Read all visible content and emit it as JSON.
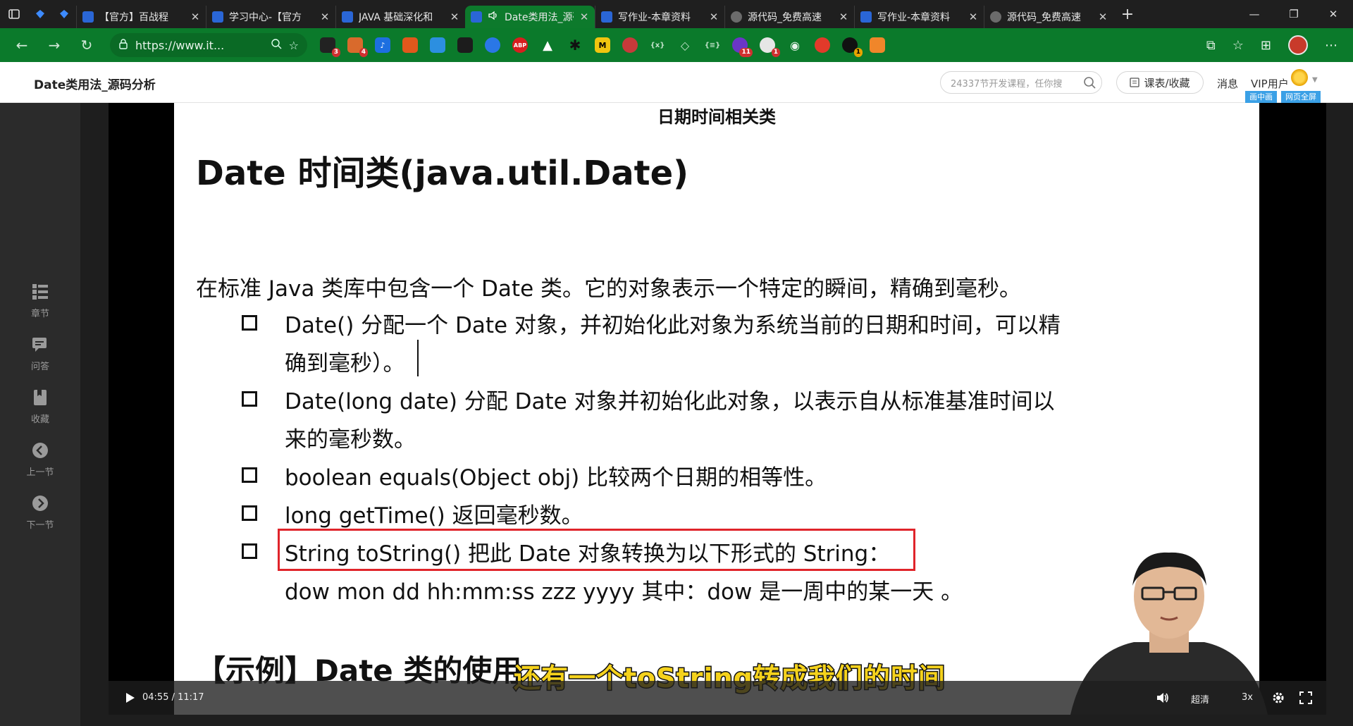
{
  "browser": {
    "tabs": [
      {
        "title": "【官方】百战程",
        "icon": "doc-icon"
      },
      {
        "title": "学习中心-【官方",
        "icon": "doc-icon"
      },
      {
        "title": "JAVA 基础深化和",
        "icon": "doc-icon"
      },
      {
        "title": "Date类用法_源码",
        "icon": "speaker-icon",
        "active": true
      },
      {
        "title": "写作业-本章资料",
        "icon": "doc-icon"
      },
      {
        "title": "源代码_免费高速",
        "icon": "cloud-icon"
      },
      {
        "title": "写作业-本章资料",
        "icon": "doc-icon"
      },
      {
        "title": "源代码_免费高速",
        "icon": "cloud-icon"
      }
    ],
    "url": "https://www.it...",
    "extension_badges": [
      "3",
      "4",
      "11",
      "1",
      "1"
    ],
    "accent": "#0b7a2b"
  },
  "site": {
    "page_title": "Date类用法_源码分析",
    "search_placeholder": "24337节开发课程，任你搜",
    "course_button": "课表/收藏",
    "messages": "消息",
    "vip": "VIP用户",
    "pip": "画中画",
    "webfull": "网页全屏"
  },
  "sidebar": {
    "items": [
      {
        "label": "章节",
        "icon": "chapters-icon"
      },
      {
        "label": "问答",
        "icon": "qa-icon"
      },
      {
        "label": "收藏",
        "icon": "bookmark-icon"
      },
      {
        "label": "上一节",
        "icon": "prev-icon"
      },
      {
        "label": "下一节",
        "icon": "next-icon"
      }
    ]
  },
  "slide": {
    "header": "日期时间相关类",
    "title": "Date 时间类(java.util.Date)",
    "intro": "在标准 Java 类库中包含一个 Date 类。它的对象表示一个特定的瞬间，精确到毫秒。",
    "bullets": [
      {
        "line1": "Date()  分配一个 Date 对象，并初始化此对象为系统当前的日期和时间，可以精",
        "line2": "确到毫秒）。"
      },
      {
        "line1": "Date(long date)  分配  Date  对象并初始化此对象，以表示自从标准基准时间以",
        "line2": "来的毫秒数。"
      },
      {
        "line1": "boolean equals(Object obj)  比较两个日期的相等性。"
      },
      {
        "line1": "long getTime()  返回毫秒数。"
      },
      {
        "line1": "String toString()  把此  Date  对象转换为以下形式的  String：",
        "line2": "dow mon dd hh:mm:ss zzz yyyy    其中：dow  是一周中的某一天  。"
      }
    ],
    "example_heading": "【示例】Date 类的使用"
  },
  "subtitle": "还有一个toString转成我们的时间",
  "player": {
    "time_current": "04:55",
    "time_total": "11:17",
    "time_label": "04:55 / 11:17",
    "quality": "超清",
    "speed": "3x"
  }
}
